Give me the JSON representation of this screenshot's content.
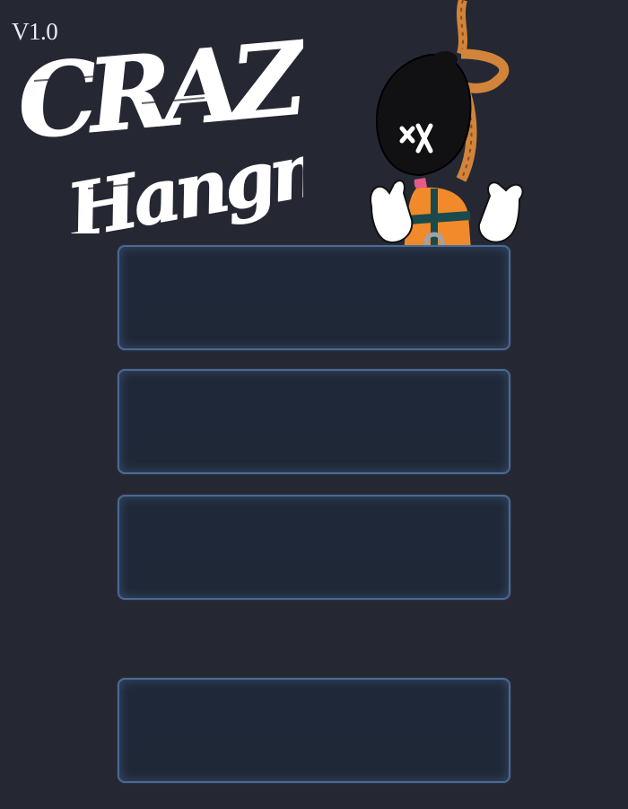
{
  "app": {
    "version": "V1.0",
    "logo_text": [
      "CRAZY",
      "Hangman"
    ]
  },
  "menu": {
    "buttons": [
      {
        "label": ""
      },
      {
        "label": ""
      },
      {
        "label": ""
      },
      {
        "label": ""
      }
    ]
  },
  "icons": {
    "mascot": "hanged-mascot-icon"
  },
  "colors": {
    "background": "#252833",
    "button_border": "#4b6a95",
    "button_fill": "#1f2838",
    "logo_text": "#ffffff",
    "rope": "#d1843a",
    "shirt": "#f08a2a"
  }
}
